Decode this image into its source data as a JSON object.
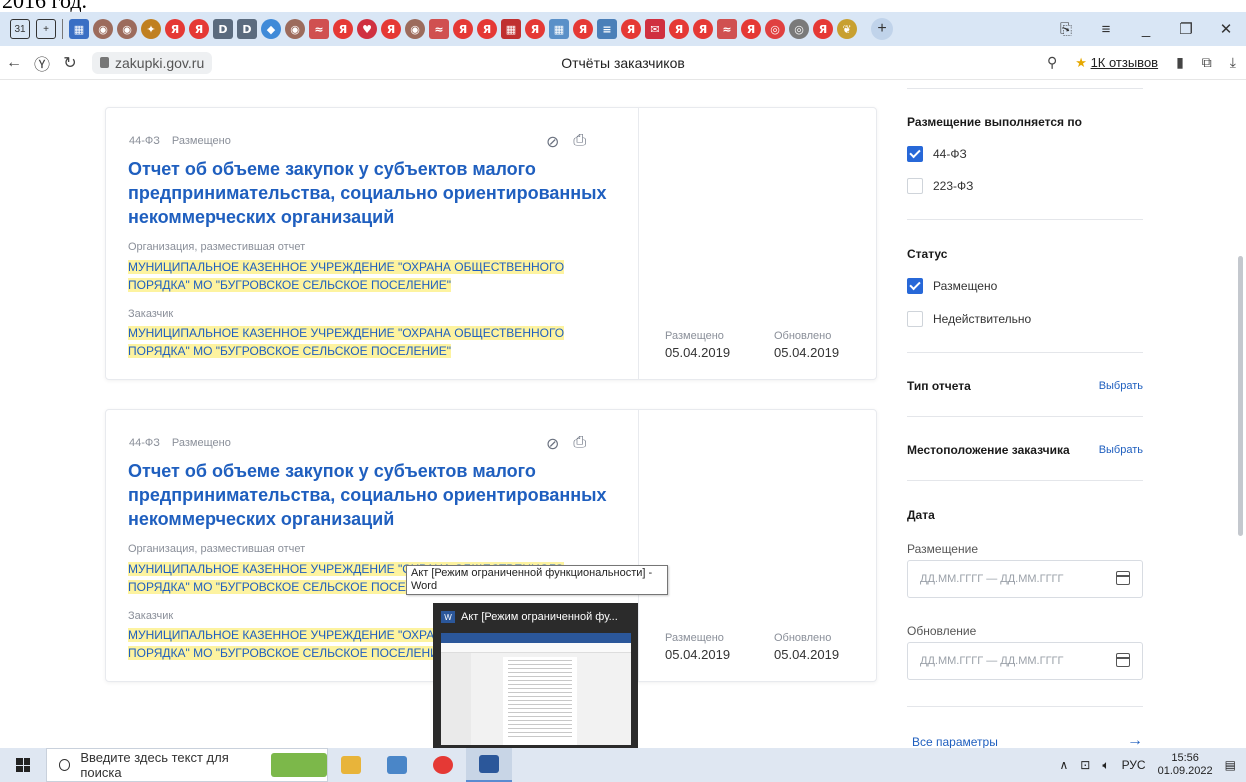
{
  "year_strip": "2016 год.",
  "browser": {
    "tab_icons": [
      {
        "name": "dashboard-tab-icon",
        "color": "#3a6fc4",
        "glyph": "▦",
        "sq": true
      },
      {
        "name": "avatar-tab-icon",
        "color": "#9c6b5c",
        "glyph": "◉"
      },
      {
        "name": "avatar-tab-icon",
        "color": "#9c6b5c",
        "glyph": "◉"
      },
      {
        "name": "emblem-tab-icon",
        "color": "#c08020",
        "glyph": "✦"
      },
      {
        "name": "yandex-tab-icon",
        "color": "#e53935",
        "glyph": "Я"
      },
      {
        "name": "yandex-tab-icon",
        "color": "#e53935",
        "glyph": "Я"
      },
      {
        "name": "document-tab-icon",
        "color": "#5b6b7e",
        "glyph": "D",
        "sq": true
      },
      {
        "name": "document-tab-icon",
        "color": "#5b6b7e",
        "glyph": "D",
        "sq": true
      },
      {
        "name": "cube-tab-icon",
        "color": "#3f8ad8",
        "glyph": "◆"
      },
      {
        "name": "avatar-tab-icon",
        "color": "#9c6b5c",
        "glyph": "◉"
      },
      {
        "name": "chart-tab-icon",
        "color": "#d05050",
        "glyph": "≈",
        "sq": true
      },
      {
        "name": "yandex-tab-icon",
        "color": "#e53935",
        "glyph": "Я"
      },
      {
        "name": "heart-tab-icon",
        "color": "#d03040",
        "glyph": "♥"
      },
      {
        "name": "yandex-tab-icon",
        "color": "#e53935",
        "glyph": "Я"
      },
      {
        "name": "avatar-tab-icon",
        "color": "#9c6b5c",
        "glyph": "◉"
      },
      {
        "name": "chart-tab-icon",
        "color": "#d05050",
        "glyph": "≈",
        "sq": true
      },
      {
        "name": "yandex-tab-icon",
        "color": "#e53935",
        "glyph": "Я"
      },
      {
        "name": "yandex-tab-icon",
        "color": "#e53935",
        "glyph": "Я"
      },
      {
        "name": "grid-tab-icon",
        "color": "#c03030",
        "glyph": "▦",
        "sq": true
      },
      {
        "name": "yandex-tab-icon",
        "color": "#e53935",
        "glyph": "Я"
      },
      {
        "name": "grid-tab-icon",
        "color": "#5a90c8",
        "glyph": "▦",
        "sq": true
      },
      {
        "name": "yandex-tab-icon",
        "color": "#e53935",
        "glyph": "Я"
      },
      {
        "name": "list-tab-icon",
        "color": "#4a7fb8",
        "glyph": "≡",
        "sq": true
      },
      {
        "name": "yandex-tab-icon",
        "color": "#e53935",
        "glyph": "Я"
      },
      {
        "name": "mail-tab-icon",
        "color": "#d03040",
        "glyph": "✉",
        "sq": true
      },
      {
        "name": "yandex-tab-icon",
        "color": "#e53935",
        "glyph": "Я"
      },
      {
        "name": "yandex-tab-icon",
        "color": "#e53935",
        "glyph": "Я"
      },
      {
        "name": "chart-tab-icon",
        "color": "#d05050",
        "glyph": "≈",
        "sq": true
      },
      {
        "name": "yandex-tab-icon",
        "color": "#e53935",
        "glyph": "Я"
      },
      {
        "name": "target-tab-icon",
        "color": "#e04040",
        "glyph": "◎"
      },
      {
        "name": "shield-tab-icon",
        "color": "#7a7a7a",
        "glyph": "◎"
      },
      {
        "name": "yandex-tab-icon",
        "color": "#e53935",
        "glyph": "Я"
      },
      {
        "name": "eagle-tab-icon",
        "color": "#c8a030",
        "glyph": "❦"
      }
    ],
    "url": "zakupki.gov.ru",
    "page_title": "Отчёты заказчиков",
    "reviews_star": "★",
    "reviews_label": "1К отзывов"
  },
  "cards": [
    {
      "law": "44-ФЗ",
      "status": "Размещено",
      "title": "Отчет об объеме закупок у субъектов малого предпринимательства, социально ориентированных некоммерческих организаций",
      "org_label": "Организация, разместившая отчет",
      "org_line1": "МУНИЦИПАЛЬНОЕ КАЗЕННОЕ УЧРЕЖДЕНИЕ \"ОХРАНА ОБЩЕСТВЕННОГО",
      "org_line2": "ПОРЯДКА\" МО \"БУГРОВСКОЕ СЕЛЬСКОЕ ПОСЕЛЕНИЕ\"",
      "customer_label": "Заказчик",
      "customer_line1": "МУНИЦИПАЛЬНОЕ КАЗЕННОЕ УЧРЕЖДЕНИЕ \"ОХРАНА ОБЩЕСТВЕННОГО",
      "customer_line2": "ПОРЯДКА\" МО \"БУГРОВСКОЕ СЕЛЬСКОЕ ПОСЕЛЕНИЕ\"",
      "placed_label": "Размещено",
      "placed_date": "05.04.2019",
      "updated_label": "Обновлено",
      "updated_date": "05.04.2019"
    },
    {
      "law": "44-ФЗ",
      "status": "Размещено",
      "title": "Отчет об объеме закупок у субъектов малого предпринимательства, социально ориентированных некоммерческих организаций",
      "org_label": "Организация, разместившая отчет",
      "org_line1": "МУНИЦИПАЛЬНОЕ КАЗЕННОЕ УЧРЕЖДЕНИЕ \"ОХРАНА ОБЩЕСТВЕННОГО",
      "org_line2": "ПОРЯДКА\" МО \"БУГРОВСКОЕ СЕЛЬСКОЕ ПОСЕЛЕНИЕ\"",
      "customer_label": "Заказчик",
      "customer_line1": "МУНИЦИПАЛЬНОЕ КАЗЕННОЕ УЧРЕЖДЕНИЕ \"ОХРАНА ОБЩЕСТВЕННОГО",
      "customer_line2": "ПОРЯДКА\" МО \"БУГРОВСКОЕ СЕЛЬСКОЕ ПОСЕЛЕНИЕ\"",
      "placed_label": "Размещено",
      "placed_date": "05.04.2019",
      "updated_label": "Обновлено",
      "updated_date": "05.04.2019"
    }
  ],
  "filters": {
    "placement_title": "Размещение выполняется по",
    "placement_options": [
      {
        "label": "44-ФЗ",
        "checked": true
      },
      {
        "label": "223-ФЗ",
        "checked": false
      }
    ],
    "status_title": "Статус",
    "status_options": [
      {
        "label": "Размещено",
        "checked": true
      },
      {
        "label": "Недействительно",
        "checked": false
      }
    ],
    "report_type_title": "Тип отчета",
    "report_type_link": "Выбрать",
    "location_title": "Местоположение заказчика",
    "location_link": "Выбрать",
    "date_title": "Дата",
    "placement_date_label": "Размещение",
    "placement_date_placeholder": "ДД.ММ.ГГГГ — ДД.ММ.ГГГГ",
    "update_date_label": "Обновление",
    "update_date_placeholder": "ДД.ММ.ГГГГ — ДД.ММ.ГГГГ",
    "all_params": "Все параметры",
    "all_params_arrow": "→"
  },
  "tooltip": {
    "line1": "Акт [Режим ограниченной функциональности] -",
    "line2": "Word"
  },
  "thumbnail": {
    "app_icon": "W",
    "title": "Акт [Режим ограниченной фу..."
  },
  "taskbar": {
    "search_placeholder": "Введите здесь текст для поиска",
    "lang": "РУС",
    "time": "15:56",
    "date": "01.09.2022"
  }
}
